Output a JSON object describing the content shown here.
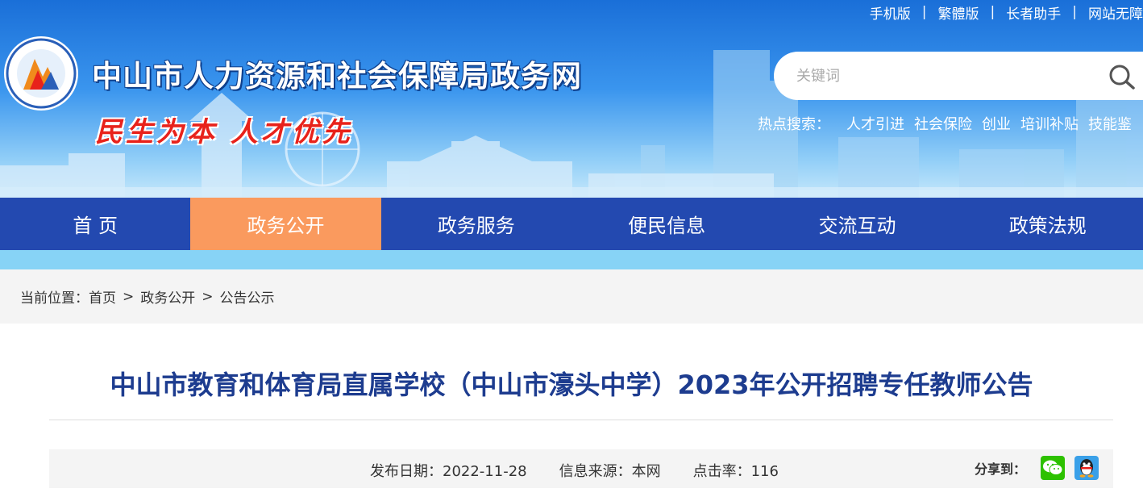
{
  "colors": {
    "nav_bg": "#2349b0",
    "nav_active_bg": "#fa9a5e",
    "title_color": "#1d3c8f",
    "slogan_color": "#e8221b",
    "strip_color": "#87d3f6",
    "wechat_green": "#2dc100",
    "qq_blue": "#3aa0e8"
  },
  "top_links": [
    "手机版",
    "繁體版",
    "长者助手",
    "网站无障"
  ],
  "top_links_separator": "|",
  "header": {
    "site_title": "中山市人力资源和社会保障局政务网",
    "slogan": "民生为本 人才优先",
    "logo_icon": "bureau-emblem-icon"
  },
  "search": {
    "placeholder": "关键词",
    "icon": "search-icon"
  },
  "hot_search": {
    "label": "热点搜索：",
    "items": [
      "人才引进",
      "社会保险",
      "创业",
      "培训补贴",
      "技能鉴"
    ]
  },
  "nav": {
    "items": [
      "首 页",
      "政务公开",
      "政务服务",
      "便民信息",
      "交流互动",
      "政策法规"
    ],
    "active": "政务公开"
  },
  "breadcrumb": {
    "label": "当前位置：",
    "items": [
      "首页",
      "政务公开",
      "公告公示"
    ],
    "separator": ">"
  },
  "article": {
    "title": "中山市教育和体育局直属学校（中山市濠头中学）2023年公开招聘专任教师公告",
    "publish_label": "发布日期：",
    "publish_date": "2022-11-28",
    "source_label": "信息来源：",
    "source": "本网",
    "clicks_label": "点击率：",
    "clicks": "116",
    "share_label": "分享到：",
    "share_icons": [
      "wechat-icon",
      "qq-icon"
    ]
  }
}
